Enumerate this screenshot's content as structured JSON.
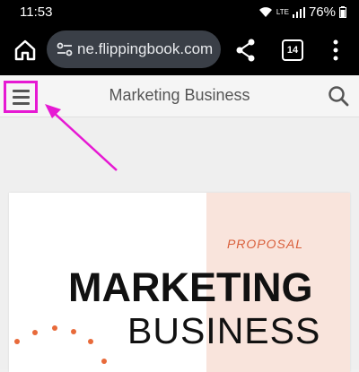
{
  "status_bar": {
    "time": "11:53",
    "network": "LTE",
    "battery": "76%"
  },
  "browser": {
    "url": "ne.flippingbook.com",
    "tab_count": "14"
  },
  "site": {
    "title": "Marketing Business"
  },
  "document": {
    "label": "PROPOSAL",
    "heading_line1": "MARKETING",
    "heading_line2": "BUSINESS"
  },
  "colors": {
    "highlight": "#e619d3",
    "accent": "#d95f3b",
    "panel": "#f9e4dc"
  }
}
